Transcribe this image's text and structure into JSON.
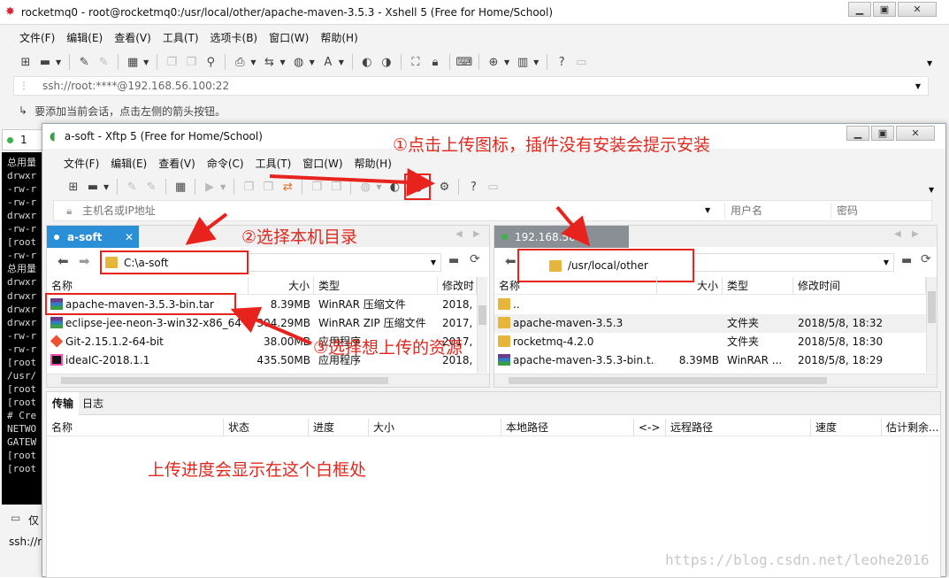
{
  "xshell": {
    "title": "rocketmq0 - root@rocketmq0:/usr/local/other/apache-maven-3.5.3 - Xshell 5 (Free for Home/School)",
    "menu": [
      "文件(F)",
      "编辑(E)",
      "查看(V)",
      "工具(T)",
      "选项卡(B)",
      "窗口(W)",
      "帮助(H)"
    ],
    "address": "ssh://root:****@192.168.56.100:22",
    "hint": "要添加当前会话，点击左侧的箭头按钮。",
    "tab_label": "1",
    "terminal_lines": [
      "总用量",
      "drwxr",
      "-rw-r",
      "-rw-r",
      "drwxr",
      "-rw-r",
      "[root",
      "-rw-r",
      "总用量",
      "drwxr",
      "drwxr",
      "drwxr",
      "drwxr",
      "-rw-r",
      "-rw-r",
      "[root",
      "/usr/",
      "[root",
      "[root",
      "# Cre",
      "NETWO",
      "GATEW",
      "[root",
      "[root"
    ],
    "status_text": "仅",
    "status_path": "ssh://r"
  },
  "xftp": {
    "title": "a-soft - Xftp 5 (Free for Home/School)",
    "menu": [
      "文件(F)",
      "编辑(E)",
      "查看(V)",
      "命令(C)",
      "工具(T)",
      "窗口(W)",
      "帮助(H)"
    ],
    "host_placeholder": "主机名或IP地址",
    "username_placeholder": "用户名",
    "password_placeholder": "密码",
    "local": {
      "tab": "a-soft",
      "path": "C:\\a-soft",
      "columns": [
        "名称",
        "大小",
        "类型",
        "修改时"
      ],
      "rows": [
        {
          "name": "apache-maven-3.5.3-bin.tar",
          "size": "8.39MB",
          "type": "WinRAR 压缩文件",
          "date": "2018,",
          "icon": "rar"
        },
        {
          "name": "eclipse-jee-neon-3-win32-x86_64",
          "size": "304.29MB",
          "type": "WinRAR ZIP 压缩文件",
          "date": "2017,",
          "icon": "rar"
        },
        {
          "name": "Git-2.15.1.2-64-bit",
          "size": "38.00MB",
          "type": "应用程序",
          "date": "2017,",
          "icon": "git"
        },
        {
          "name": "ideaIC-2018.1.1",
          "size": "435.50MB",
          "type": "应用程序",
          "date": "2018,",
          "icon": "idea"
        }
      ]
    },
    "remote": {
      "tab": "192.168.56.1",
      "path": "/usr/local/other",
      "columns": [
        "名称",
        "大小",
        "类型",
        "修改时间"
      ],
      "rows": [
        {
          "name": "..",
          "size": "",
          "type": "",
          "date": "",
          "icon": "folder"
        },
        {
          "name": "apache-maven-3.5.3",
          "size": "",
          "type": "文件夹",
          "date": "2018/5/8, 18:32",
          "icon": "folder"
        },
        {
          "name": "rocketmq-4.2.0",
          "size": "",
          "type": "文件夹",
          "date": "2018/5/8, 18:30",
          "icon": "folder"
        },
        {
          "name": "apache-maven-3.5.3-bin.t...",
          "size": "8.39MB",
          "type": "WinRAR ...",
          "date": "2018/5/8, 18:29",
          "icon": "rar"
        }
      ]
    },
    "transfer": {
      "tabs": [
        "传输",
        "日志"
      ],
      "columns": [
        "名称",
        "状态",
        "进度",
        "大小",
        "本地路径",
        "<->",
        "远程路径",
        "速度",
        "估计剩余..."
      ]
    }
  },
  "annotations": {
    "step1": "①点击上传图标，插件没有安装会提示安装",
    "step2": "②选择本机目录",
    "step3": "③选择想上传的资源",
    "step4": "上传进度会显示在这个白框处"
  },
  "watermark": "https://blog.csdn.net/leohe2016",
  "colors": {
    "accent": "#2b8fd8",
    "annotation": "#e0281e",
    "online_dot": "#3bb34a"
  }
}
